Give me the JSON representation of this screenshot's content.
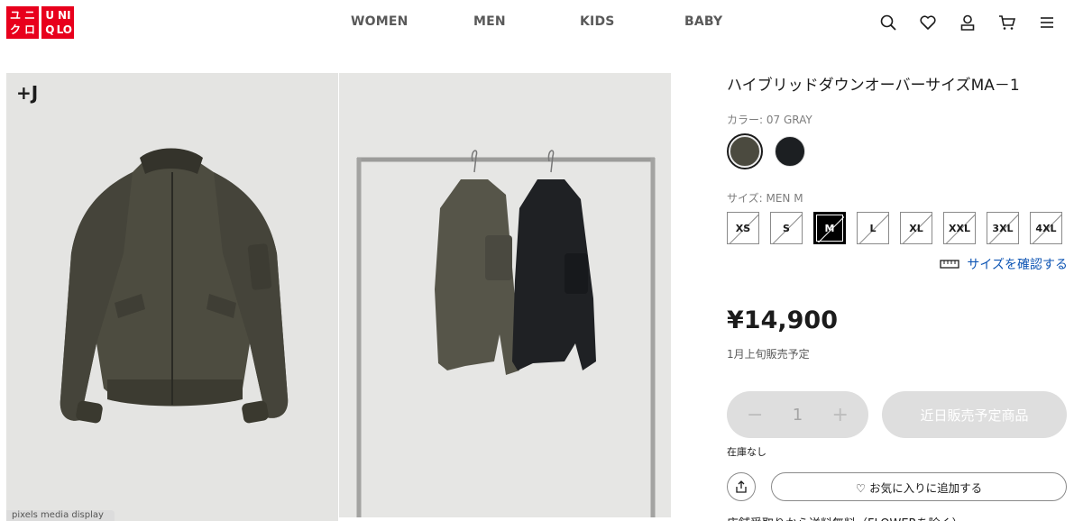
{
  "brand": {
    "logo_left": [
      "ユ",
      "ニ",
      "ク",
      "ロ"
    ],
    "logo_right": [
      "U",
      "NI",
      "Q",
      "LO"
    ],
    "color": "#e8001c"
  },
  "nav": {
    "items": [
      "WOMEN",
      "MEN",
      "KIDS",
      "BABY"
    ]
  },
  "header_icons": [
    "search-icon",
    "heart-icon",
    "account-icon",
    "cart-icon",
    "menu-icon"
  ],
  "gallery": {
    "badge": "+J",
    "caption": "pixels media display"
  },
  "product": {
    "title": "ハイブリッドダウンオーバーサイズMA－1",
    "color_label": "カラー: 07 GRAY",
    "colors": [
      {
        "name": "07 GRAY",
        "hex": "#4b4a3f",
        "selected": true
      },
      {
        "name": "BLACK",
        "hex": "#1c1f22",
        "selected": false
      }
    ],
    "size_label": "サイズ: MEN M",
    "sizes": [
      "XS",
      "S",
      "M",
      "L",
      "XL",
      "XXL",
      "3XL",
      "4XL"
    ],
    "selected_size": "M",
    "size_check_link": "サイズを確認する",
    "price": "¥14,900",
    "release_note": "1月上旬販売予定",
    "quantity": {
      "minus": "−",
      "value": "1",
      "plus": "+"
    },
    "add_button": "近日販売予定商品",
    "stock_note": "在庫なし",
    "favorite_button": "♡ お気に入りに追加する",
    "shipping_note": "店舗受取りから送料無料（FLOWERを除く）"
  }
}
